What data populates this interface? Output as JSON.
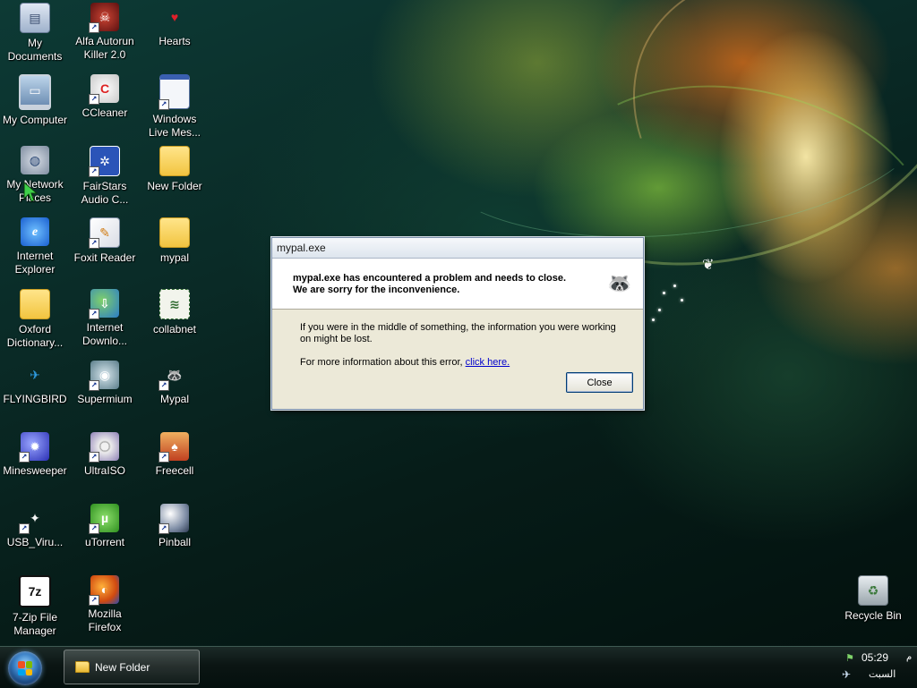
{
  "desktop": {
    "icons": [
      {
        "label": "My Documents",
        "glyph": "▤",
        "style": "ic-docs"
      },
      {
        "label": "Alfa Autorun Killer 2.0",
        "glyph": "☠",
        "style": "ic-killer"
      },
      {
        "label": "Hearts",
        "glyph": "♥",
        "style": "ic-hearts"
      },
      {
        "label": "My Computer",
        "glyph": "▭",
        "style": "ic-comp"
      },
      {
        "label": "CCleaner",
        "glyph": "C",
        "style": "ic-ccleaner"
      },
      {
        "label": "Windows Live Mes...",
        "glyph": "",
        "style": "ic-wlm"
      },
      {
        "label": "My Network Places",
        "glyph": "◍",
        "style": "ic-net"
      },
      {
        "label": "FairStars Audio C...",
        "glyph": "✲",
        "style": "ic-fair"
      },
      {
        "label": "New Folder",
        "glyph": "",
        "style": "ic-folder"
      },
      {
        "label": "Internet Explorer",
        "glyph": "e",
        "style": "ic-ie"
      },
      {
        "label": "Foxit Reader",
        "glyph": "✎",
        "style": "ic-foxit"
      },
      {
        "label": "mypal",
        "glyph": "",
        "style": "ic-folder"
      },
      {
        "label": "Oxford Dictionary...",
        "glyph": "",
        "style": "ic-folder"
      },
      {
        "label": "Internet Downlo...",
        "glyph": "⇩",
        "style": "ic-idm"
      },
      {
        "label": "collabnet",
        "glyph": "≋",
        "style": "ic-collab"
      },
      {
        "label": "FLYINGBIRD",
        "glyph": "✈",
        "style": "ic-bird"
      },
      {
        "label": "Supermium",
        "glyph": "◉",
        "style": "ic-super"
      },
      {
        "label": "Mypal",
        "glyph": "🦝",
        "style": "ic-mypal"
      },
      {
        "label": "Minesweeper",
        "glyph": "✹",
        "style": "ic-mine"
      },
      {
        "label": "UltraISO",
        "glyph": "",
        "style": "ic-ultra"
      },
      {
        "label": "Freecell",
        "glyph": "♠",
        "style": "ic-free"
      },
      {
        "label": "USB_Viru...",
        "glyph": "✦",
        "style": "ic-usb"
      },
      {
        "label": "uTorrent",
        "glyph": "µ",
        "style": "ic-utor"
      },
      {
        "label": "Pinball",
        "glyph": "",
        "style": "ic-pin"
      },
      {
        "label": "7-Zip File Manager",
        "glyph": "7z",
        "style": "ic-7z"
      },
      {
        "label": "Mozilla Firefox",
        "glyph": "◐",
        "style": "ic-ff"
      },
      {
        "label": "Recycle Bin",
        "glyph": "♻",
        "style": "ic-bin"
      }
    ]
  },
  "dialog": {
    "title": "mypal.exe",
    "header_message": "mypal.exe has encountered a problem and needs to close.  We are sorry for the inconvenience.",
    "body_text": "If you were in the middle of something, the information you were working on might be lost.",
    "more_info_prefix": "For more information about this error, ",
    "link_label": "click here.",
    "close_label": "Close"
  },
  "taskbar": {
    "task_label": "New Folder",
    "clock_time": "05:29",
    "clock_ampm": "م",
    "clock_day": "السبت"
  },
  "colors": {
    "flag_red": "#f25022",
    "flag_green": "#7fba00",
    "flag_blue": "#00a4ef",
    "flag_yellow": "#ffb900"
  }
}
